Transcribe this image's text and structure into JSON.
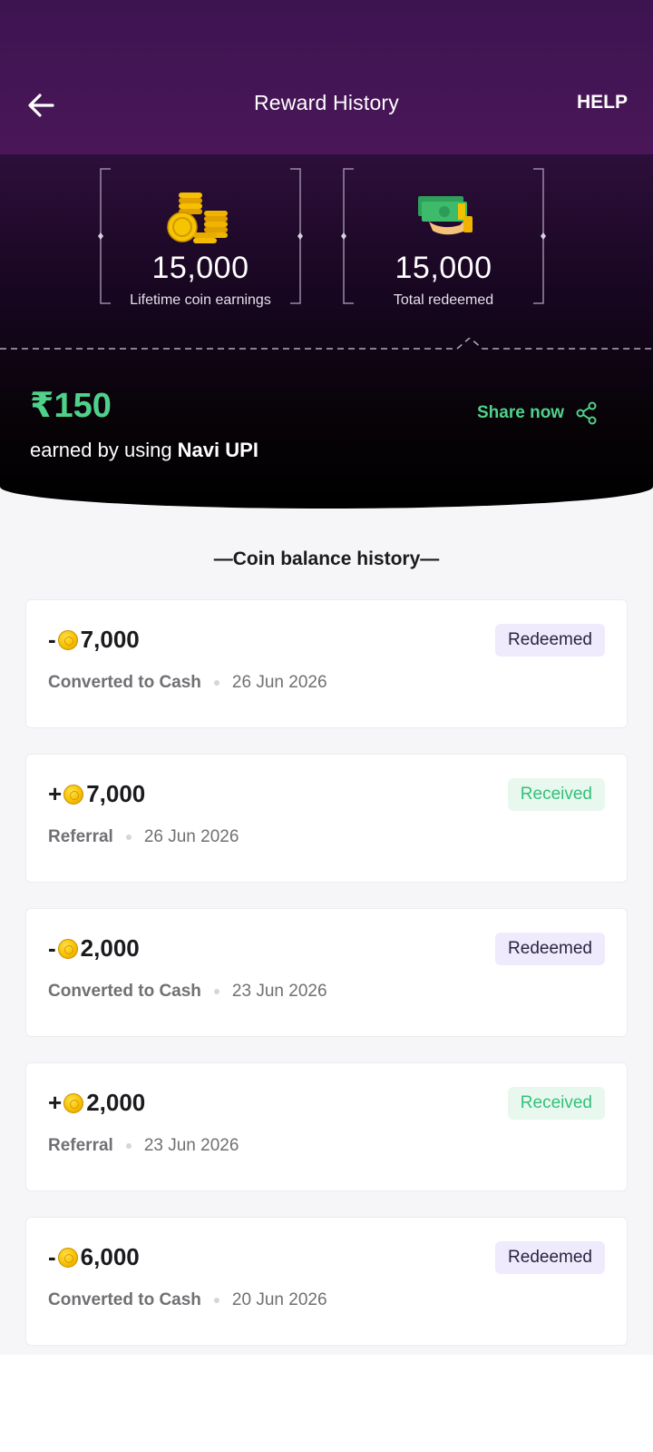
{
  "header": {
    "title": "Reward History",
    "help_label": "HELP"
  },
  "stats": {
    "lifetime": {
      "value": "15,000",
      "label": "Lifetime coin earnings",
      "icon": "coins-stack-icon"
    },
    "redeemed": {
      "value": "15,000",
      "label": "Total redeemed",
      "icon": "cash-hand-icon"
    }
  },
  "upi": {
    "amount": "₹150",
    "text_prefix": "earned by using ",
    "text_bold": "Navi UPI",
    "share_label": "Share now"
  },
  "history": {
    "title": "—Coin balance history—",
    "items": [
      {
        "sign": "-",
        "amount": "7,000",
        "type": "Converted to Cash",
        "date": "26 Jun 2026",
        "status": "Redeemed",
        "status_kind": "redeemed"
      },
      {
        "sign": "+",
        "amount": "7,000",
        "type": "Referral",
        "date": "26 Jun 2026",
        "status": "Received",
        "status_kind": "received"
      },
      {
        "sign": "-",
        "amount": "2,000",
        "type": "Converted to Cash",
        "date": "23 Jun 2026",
        "status": "Redeemed",
        "status_kind": "redeemed"
      },
      {
        "sign": "+",
        "amount": "2,000",
        "type": "Referral",
        "date": "23 Jun 2026",
        "status": "Received",
        "status_kind": "received"
      },
      {
        "sign": "-",
        "amount": "6,000",
        "type": "Converted to Cash",
        "date": "20 Jun 2026",
        "status": "Redeemed",
        "status_kind": "redeemed"
      }
    ]
  },
  "colors": {
    "header_bg": "#4a1658",
    "accent_green": "#4fd18b",
    "redeemed_bg": "#efeafc",
    "received_bg": "#e8f8ef"
  }
}
